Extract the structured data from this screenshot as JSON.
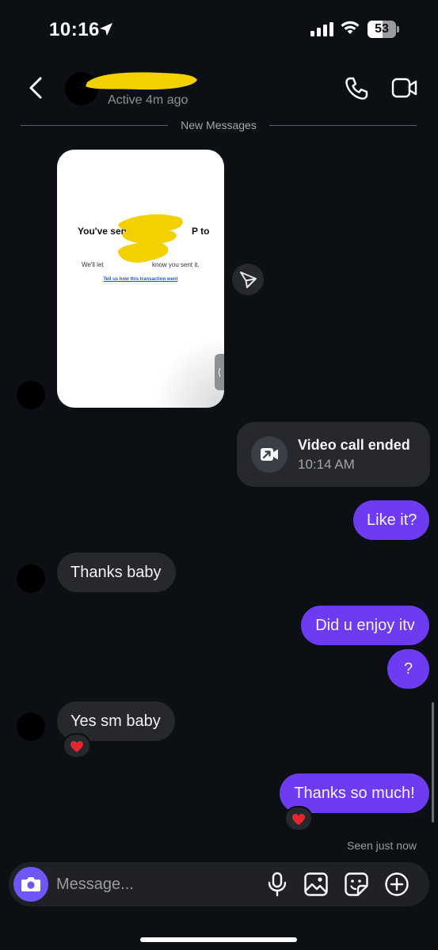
{
  "status_bar": {
    "time": "10:16",
    "battery": "53",
    "battery_level": 0.53
  },
  "header": {
    "status": "Active 4m ago"
  },
  "divider": {
    "label": "New Messages"
  },
  "shared_screenshot": {
    "title": "You've sent",
    "title_end": "P to",
    "subtitle": "We'll let",
    "subtitle_end": "know you sent it.",
    "link": "Tell us how this transaction went"
  },
  "messages": {
    "call_title": "Video call ended",
    "call_time": "10:14 AM",
    "m1": "Like it?",
    "m2": "Thanks baby",
    "m3": "Did u enjoy itv",
    "m4": "?",
    "m5": "Yes sm baby",
    "m6": "Thanks so much!",
    "reaction": "❤️"
  },
  "seen": "Seen just now",
  "composer": {
    "placeholder": "Message..."
  },
  "colors": {
    "background": "#0c0f14",
    "incoming_bubble": "#26282e",
    "outgoing_bubble": "#6d3cf2",
    "camera_button": "#6d57f6",
    "redaction": "#f3d000"
  },
  "icons": {
    "back": "chevron-left-icon",
    "call": "phone-icon",
    "video": "video-camera-icon",
    "share": "send-icon",
    "call_card": "video-call-icon",
    "camera": "camera-icon",
    "mic": "microphone-icon",
    "gallery": "gallery-icon",
    "sticker": "sticker-icon",
    "add": "plus-circle-icon"
  }
}
